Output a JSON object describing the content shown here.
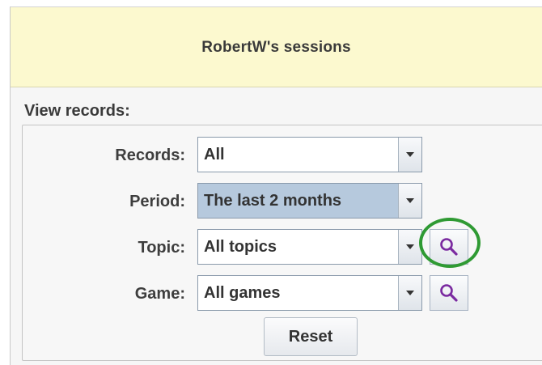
{
  "header": {
    "title": "RobertW's sessions"
  },
  "view_records": {
    "section_label": "View records:",
    "rows": [
      {
        "label": "Records:",
        "value": "All"
      },
      {
        "label": "Period:",
        "value": "The last 2 months"
      },
      {
        "label": "Topic:",
        "value": "All topics"
      },
      {
        "label": "Game:",
        "value": "All games"
      }
    ],
    "reset_label": "Reset"
  },
  "icons": {
    "dropdown": "chevron-down-icon",
    "search": "magnifier-icon"
  },
  "colors": {
    "header_background": "#fcf9cf",
    "selected_field": "#b6c9dd",
    "search_icon": "#7a2aa0",
    "highlight_ring": "#2f9a33"
  }
}
